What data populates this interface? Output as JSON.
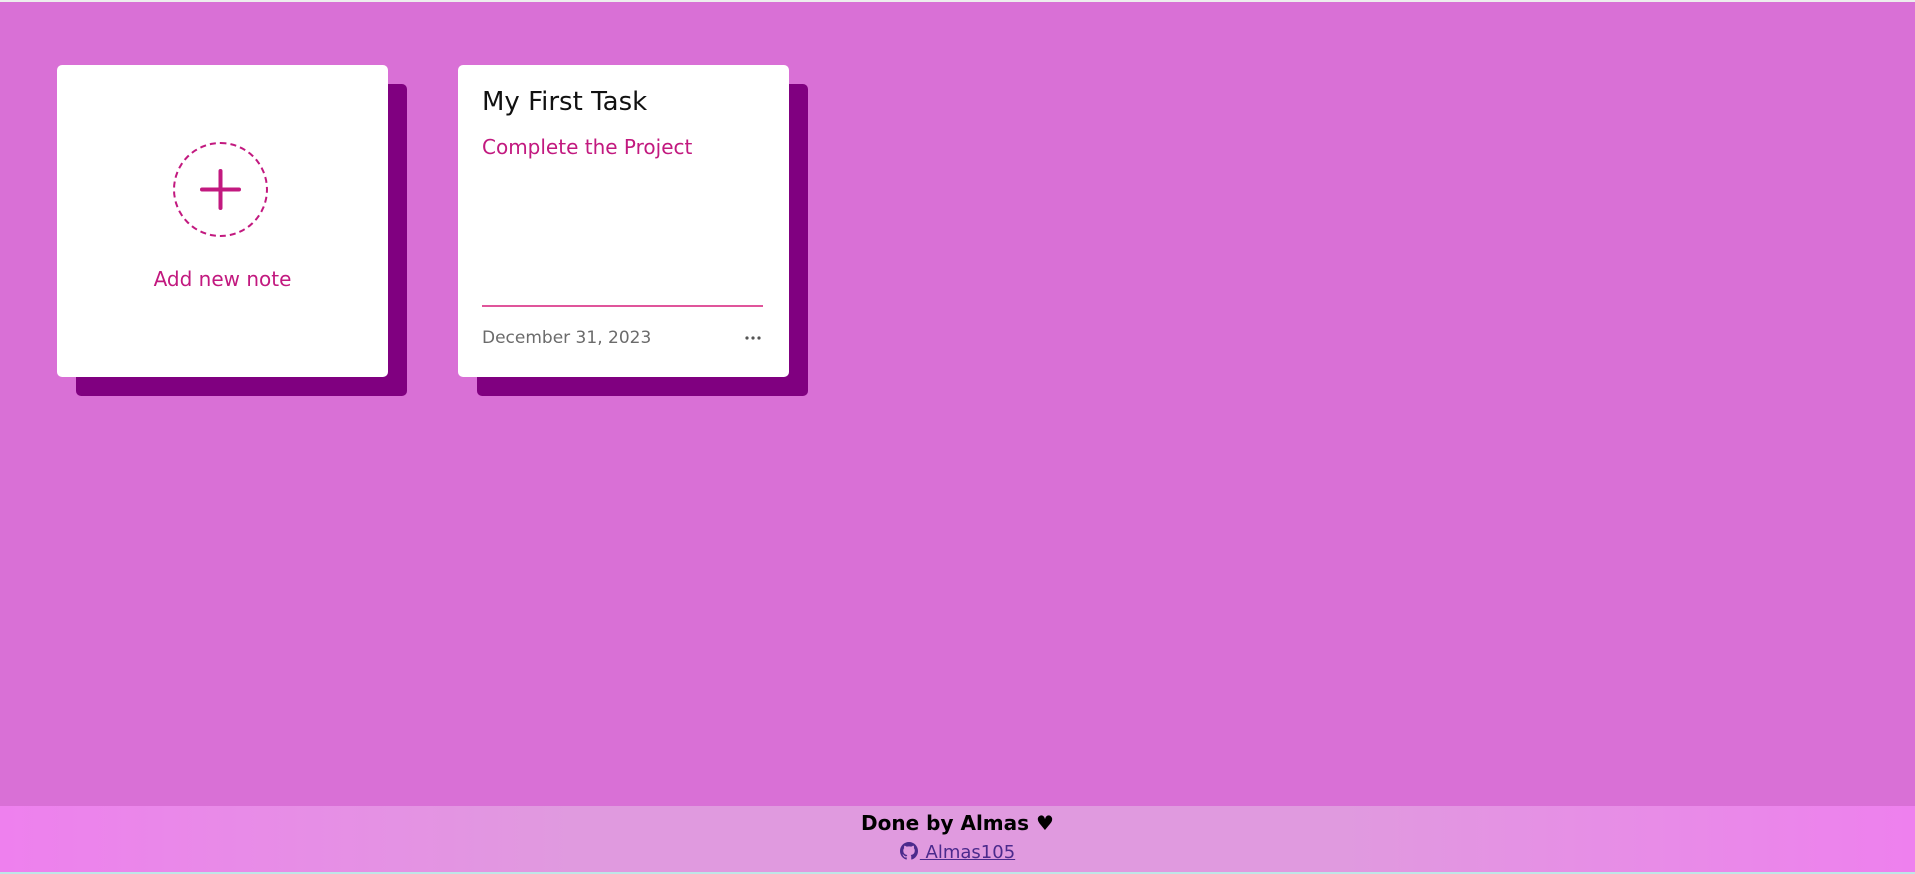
{
  "colors": {
    "background": "#d970d6",
    "accent": "#c2197f",
    "card_shadow": "#800080",
    "card": "#ffffff",
    "footer_link": "#4b2a8c"
  },
  "add_card": {
    "icon": "plus-icon",
    "label": "Add new note"
  },
  "notes": [
    {
      "title": "My First Task",
      "description": "Complete the Project",
      "date": "December 31, 2023",
      "menu_icon": "more-horizontal-icon"
    }
  ],
  "footer": {
    "credit": "Done by Almas ♥",
    "github_icon": "github-icon",
    "github_label": " Almas105"
  }
}
